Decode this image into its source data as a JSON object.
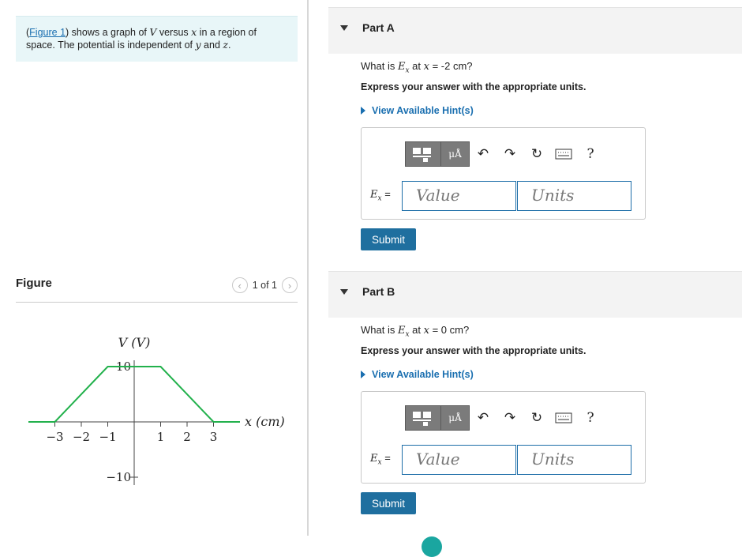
{
  "intro": {
    "link": "Figure 1",
    "t1": ") shows a graph of ",
    "var_v": "V",
    "t2": " versus ",
    "var_x": "x",
    "t3": " in a region of space. The potential is independent of ",
    "var_y": "y",
    "t4": " and ",
    "var_z": "z",
    "t5": "."
  },
  "figure": {
    "title": "Figure",
    "pager": "1 of 1",
    "prev_icon": "‹",
    "next_icon": "›"
  },
  "chart_data": {
    "type": "line",
    "xlabel": "x (cm)",
    "ylabel": "V (V)",
    "x_ticks": [
      "−3",
      "−2",
      "−1",
      "1",
      "2",
      "3"
    ],
    "y_ticks": [
      "10",
      "−10"
    ],
    "x": [
      -4,
      -3,
      -1,
      1,
      3,
      4
    ],
    "y": [
      0,
      0,
      10,
      10,
      0,
      0
    ],
    "line_color": "#22b14c",
    "xlim": [
      -4,
      4
    ],
    "ylim": [
      -10,
      10
    ]
  },
  "parts": [
    {
      "title": "Part A",
      "q_pre": "What is ",
      "q_var": "E",
      "q_sub": "x",
      "q_mid": " at ",
      "q_x": "x",
      "q_val": " = -2 cm?",
      "express": "Express your answer with the appropriate units.",
      "hint": "View Available Hint(s)",
      "label_var": "E",
      "label_sub": "x",
      "label_eq": " =",
      "value_placeholder": "Value",
      "units_placeholder": "Units",
      "submit": "Submit"
    },
    {
      "title": "Part B",
      "q_pre": "What is ",
      "q_var": "E",
      "q_sub": "x",
      "q_mid": " at ",
      "q_x": "x",
      "q_val": " = 0 cm?",
      "express": "Express your answer with the appropriate units.",
      "hint": "View Available Hint(s)",
      "label_var": "E",
      "label_sub": "x",
      "label_eq": " =",
      "value_placeholder": "Value",
      "units_placeholder": "Units",
      "submit": "Submit"
    }
  ],
  "toolbar": {
    "units_button": "μÅ",
    "undo_icon": "↶",
    "redo_icon": "↷",
    "reset_icon": "↻",
    "help": "?"
  },
  "colors": {
    "accent": "#1a6fb0",
    "submit": "#1f6f9f",
    "intro_bg": "#e8f6f8",
    "plot_line": "#22b14c"
  }
}
